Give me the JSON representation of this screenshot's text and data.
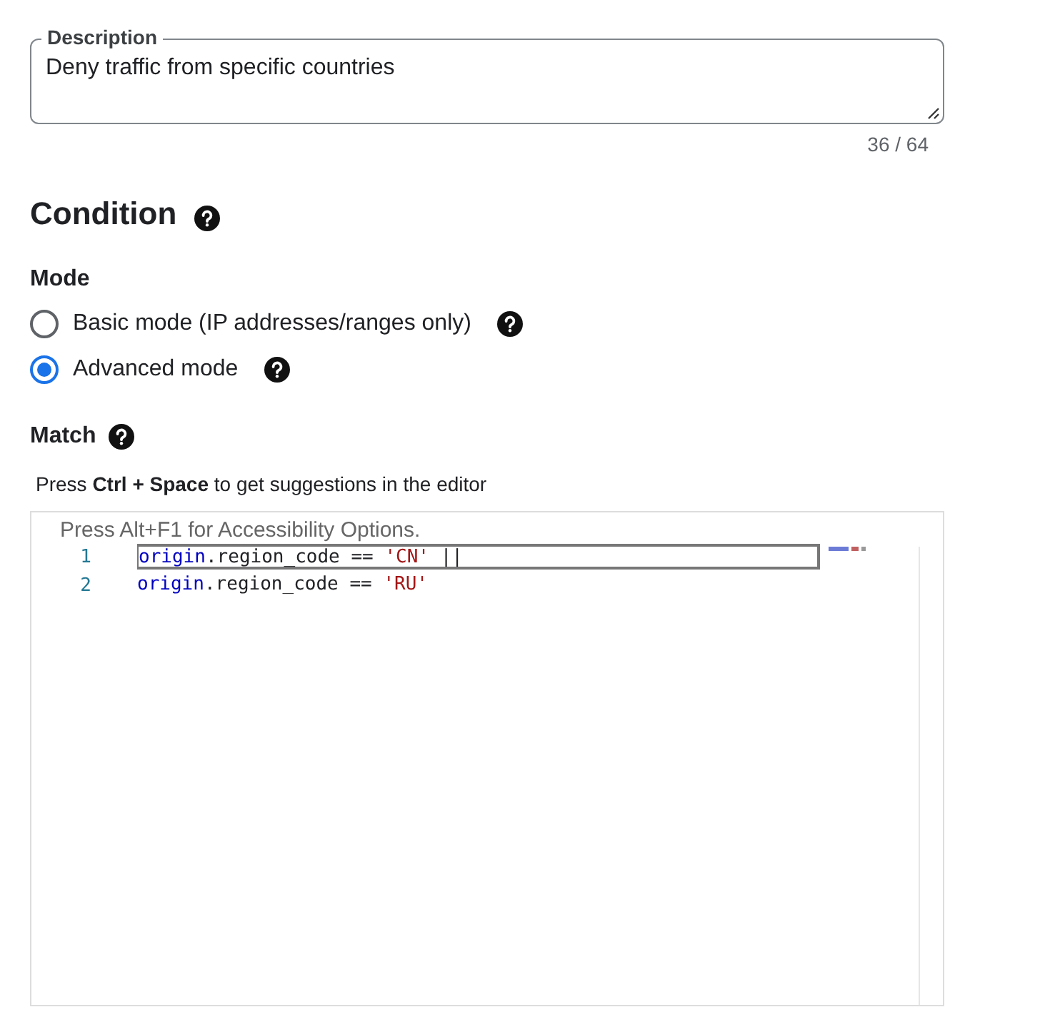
{
  "description_field": {
    "label": "Description",
    "value": "Deny traffic from specific countries",
    "counter": "36 / 64"
  },
  "condition": {
    "title": "Condition"
  },
  "mode": {
    "label": "Mode",
    "options": [
      {
        "label": "Basic mode (IP addresses/ranges only)",
        "selected": false
      },
      {
        "label": "Advanced mode",
        "selected": true
      }
    ]
  },
  "match": {
    "label": "Match",
    "hint": "Press **Ctrl + Space** to get suggestions in the editor"
  },
  "editor": {
    "accessibility_hint": "Press Alt+F1 for Accessibility Options.",
    "lines": [
      {
        "number": "1",
        "current": true,
        "tokens": [
          {
            "kind": "ident",
            "text": "origin"
          },
          {
            "kind": "plain",
            "text": ".region_code == "
          },
          {
            "kind": "string",
            "text": "'CN'"
          },
          {
            "kind": "plain",
            "text": " ||"
          }
        ]
      },
      {
        "number": "2",
        "current": false,
        "tokens": [
          {
            "kind": "ident",
            "text": "origin"
          },
          {
            "kind": "plain",
            "text": ".region_code == "
          },
          {
            "kind": "string",
            "text": "'RU'"
          }
        ]
      }
    ]
  }
}
